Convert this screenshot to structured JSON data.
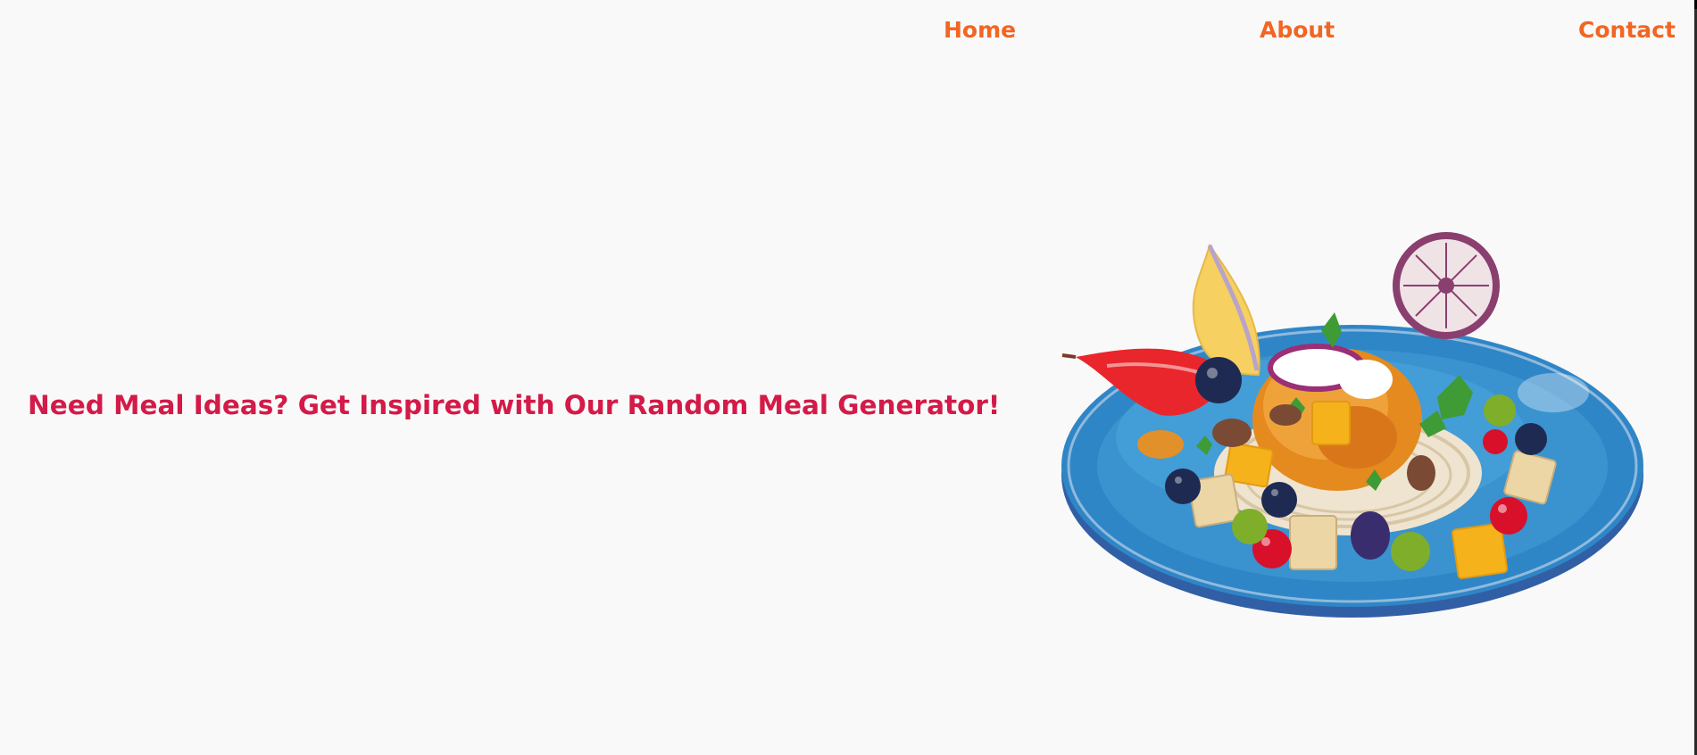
{
  "nav": {
    "home_label": "Home",
    "about_label": "About",
    "contact_label": "Contact"
  },
  "hero": {
    "headline": "Need Meal Ideas? Get Inspired with Our Random Meal Generator!",
    "image_icon": "plated-meal-image"
  },
  "colors": {
    "nav_link": "#f26522",
    "headline": "#d31a48",
    "background": "#f9f9f9",
    "plate": "#2f86c7"
  }
}
